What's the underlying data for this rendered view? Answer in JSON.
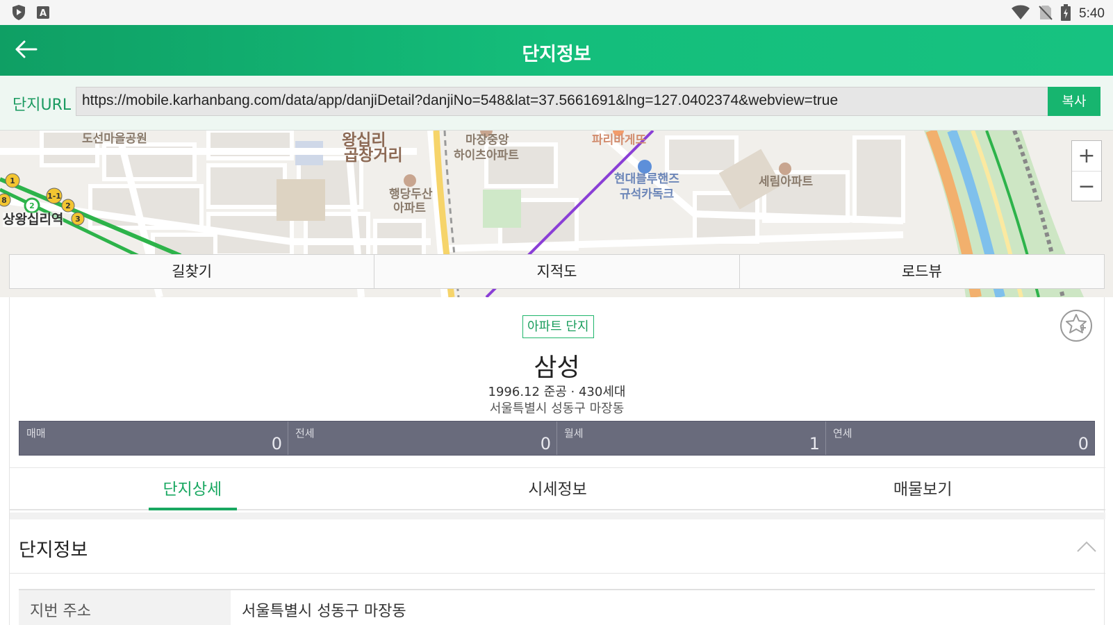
{
  "status_bar": {
    "left_icons": [
      "shield-icon",
      "keyboard-a-icon"
    ],
    "right_icons": [
      "wifi-icon",
      "no-sim-icon",
      "battery-charging-icon"
    ],
    "time": "5:40"
  },
  "header": {
    "back_icon": "arrow-left-icon",
    "title": "단지정보"
  },
  "url_row": {
    "label": "단지URL",
    "value": "https://mobile.karhanbang.com/data/app/danjiDetail?danjiNo=548&lat=37.5661691&lng=127.0402374&webview=true",
    "copy_label": "복사"
  },
  "map": {
    "labels": {
      "park": "도선마을공원",
      "gopchang_1": "왕십리",
      "gopchang_2": "곱창거리",
      "majang_1": "마장중앙",
      "majang_2": "하이츠아파트",
      "paris": "파리바게뜨",
      "hyundai_1": "현대블루핸즈",
      "hyundai_2": "규석카독크",
      "serim": "세림아파트",
      "haengdang_1": "행당두산",
      "haengdang_2": "아파트",
      "station": "상왕십리역"
    },
    "zoom_in": "+",
    "zoom_out": "−",
    "buttons": [
      "길찾기",
      "지적도",
      "로드뷰"
    ]
  },
  "complex": {
    "type_badge": "아파트 단지",
    "name": "삼성",
    "summary": "1996.12 준공 · 430세대",
    "address": "서울특별시 성동구 마장동",
    "favorite_icon": "star-plus-icon",
    "counts": [
      {
        "label": "매매",
        "value": "0"
      },
      {
        "label": "전세",
        "value": "0"
      },
      {
        "label": "월세",
        "value": "1"
      },
      {
        "label": "연세",
        "value": "0"
      }
    ]
  },
  "tabs": [
    {
      "label": "단지상세",
      "active": true
    },
    {
      "label": "시세정보",
      "active": false
    },
    {
      "label": "매물보기",
      "active": false
    }
  ],
  "section": {
    "title": "단지정보",
    "chevron_icon": "chevron-up-icon"
  },
  "info_rows": [
    {
      "key": "지번 주소",
      "value": "서울특별시 성동구 마장동"
    }
  ],
  "colors": {
    "header_green": "#14be7b",
    "accent_green": "#1aa862",
    "counts_bg": "#696b7c"
  }
}
